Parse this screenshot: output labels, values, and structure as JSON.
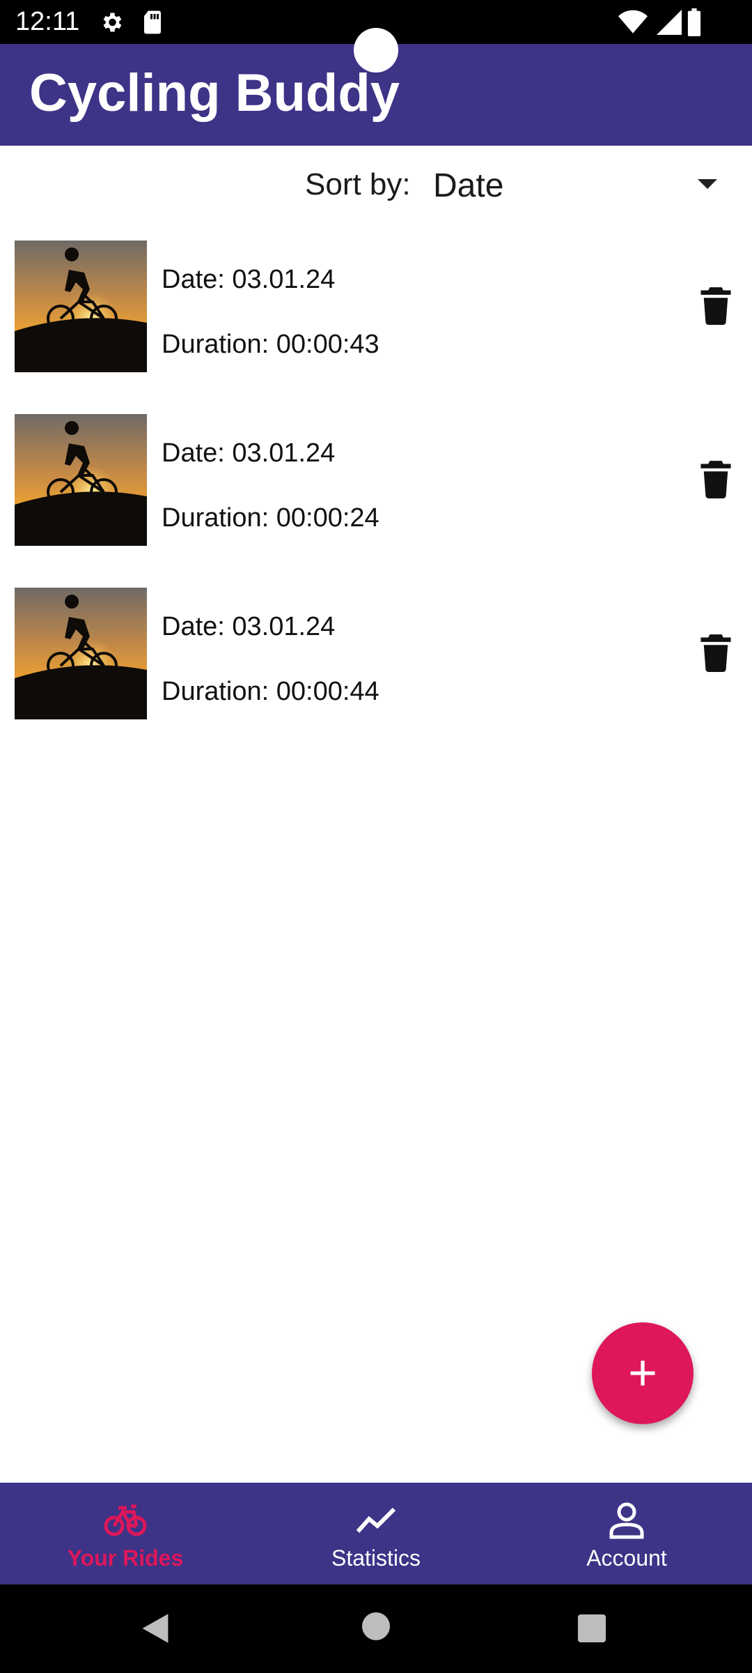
{
  "status_bar": {
    "time": "12:11",
    "icons": [
      "gear-icon",
      "sd-card-icon",
      "wifi-icon",
      "signal-icon",
      "battery-icon"
    ]
  },
  "app_bar": {
    "title": "Cycling Buddy",
    "background": "#3d3387"
  },
  "sort": {
    "label": "Sort by:",
    "selected": "Date"
  },
  "rides": [
    {
      "date": "Date: 03.01.24",
      "duration": "Duration: 00:00:43"
    },
    {
      "date": "Date: 03.01.24",
      "duration": "Duration: 00:00:24"
    },
    {
      "date": "Date: 03.01.24",
      "duration": "Duration: 00:00:44"
    }
  ],
  "fab": {
    "icon": "plus-icon",
    "color": "#dd1759"
  },
  "bottom_nav": {
    "items": [
      {
        "label": "Your Rides",
        "icon": "bicycle-icon",
        "active": true
      },
      {
        "label": "Statistics",
        "icon": "chart-line-icon",
        "active": false
      },
      {
        "label": "Account",
        "icon": "person-icon",
        "active": false
      }
    ],
    "active_color": "#dd1759"
  },
  "system_nav": {
    "icons": [
      "back-icon",
      "home-icon",
      "recents-icon"
    ]
  }
}
